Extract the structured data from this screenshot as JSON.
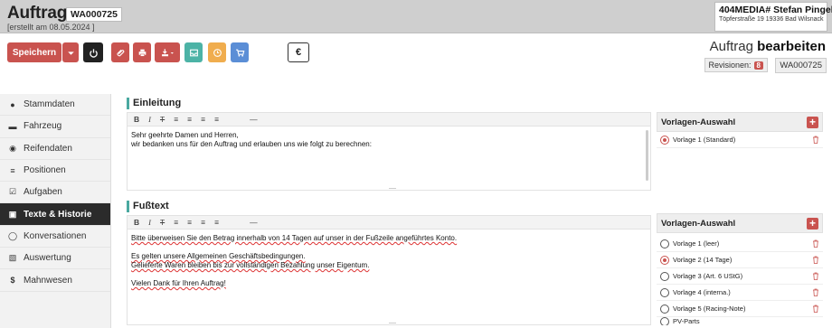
{
  "header": {
    "title": "Auftrag",
    "order_id": "WA000725",
    "created": "[erstellt am 08.05.2024 ]",
    "company_name": "404MEDIA# Stefan Pingel",
    "company_address": "Töpferstraße 19 19336 Bad Wilsnack"
  },
  "toolbar": {
    "save_label": "Speichern",
    "euro_label": "€",
    "mode_prefix": "Auftrag",
    "mode_bold": "bearbeiten",
    "revisions_label": "Revisionen:",
    "revisions_count": "8",
    "revision_id": "WA000725"
  },
  "sidebar": {
    "items": [
      {
        "label": "Stammdaten",
        "icon": "user-icon"
      },
      {
        "label": "Fahrzeug",
        "icon": "car-icon"
      },
      {
        "label": "Reifendaten",
        "icon": "tire-icon"
      },
      {
        "label": "Positionen",
        "icon": "list-icon"
      },
      {
        "label": "Aufgaben",
        "icon": "checkbox-icon"
      },
      {
        "label": "Texte & Historie",
        "icon": "document-icon"
      },
      {
        "label": "Konversationen",
        "icon": "speech-bubble-icon"
      },
      {
        "label": "Auswertung",
        "icon": "chart-icon"
      },
      {
        "label": "Mahnwesen",
        "icon": "dollar-icon"
      }
    ],
    "active": "Texte & Historie"
  },
  "einleitung": {
    "heading": "Einleitung",
    "lines": [
      "Sehr geehrte Damen und Herren,",
      "wir bedanken uns für den Auftrag und erlauben uns wie folgt zu berechnen:"
    ],
    "panel_title": "Vorlagen-Auswahl",
    "templates": [
      {
        "label": "Vorlage 1 (Standard)",
        "selected": true
      }
    ]
  },
  "fusstext": {
    "heading": "Fußtext",
    "lines": [
      "Bitte überweisen Sie den Betrag innerhalb von 14 Tagen auf unser in der Fußzeile angeführtes Konto.",
      "",
      "Es gelten unsere Allgemeinen Geschäftsbedingungen.",
      "Gelieferte Waren bleiben bis zur vollständigen Bezahlung unser Eigentum.",
      "",
      "Vielen Dank für Ihren Auftrag!"
    ],
    "panel_title": "Vorlagen-Auswahl",
    "templates": [
      {
        "label": "Vorlage 1 (leer)",
        "selected": false
      },
      {
        "label": "Vorlage 2 (14 Tage)",
        "selected": true
      },
      {
        "label": "Vorlage 3 (Art. 6 UStG)",
        "selected": false
      },
      {
        "label": "Vorlage 4 (interna.)",
        "selected": false
      },
      {
        "label": "Vorlage 5 (Racing-Note)",
        "selected": false
      },
      {
        "label": "PV-Parts",
        "selected": false
      }
    ]
  },
  "editor": {
    "tools": [
      "B",
      "I",
      "T",
      "≡",
      "≡",
      "≡",
      "≡",
      "—"
    ]
  },
  "colors": {
    "accent": "#c9534f",
    "section_bar": "#4aa9a0",
    "active_nav": "#2b2b2b"
  }
}
